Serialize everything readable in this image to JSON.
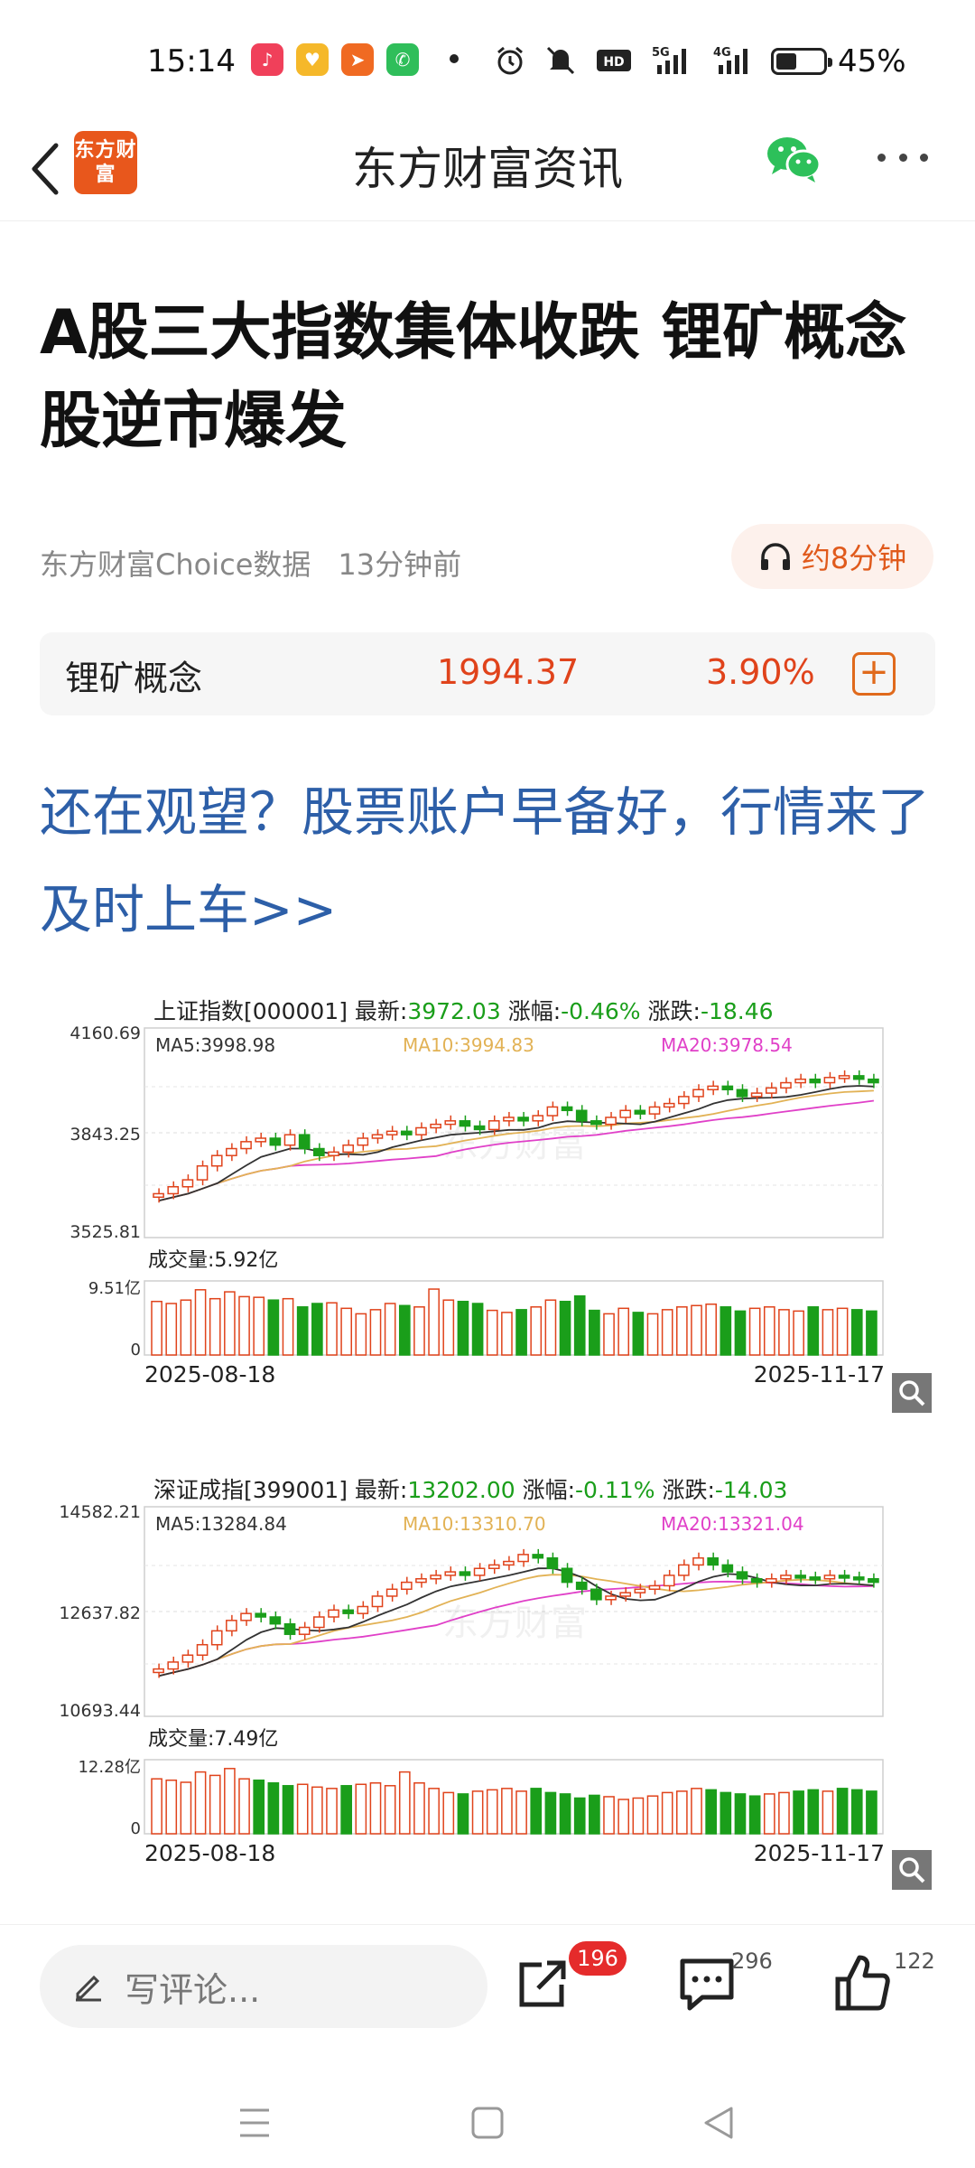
{
  "status_bar": {
    "time": "15:14",
    "battery_pct": "45%",
    "network_1": "5G",
    "network_2": "4G",
    "hd_label": "HD"
  },
  "header": {
    "logo_text": "东方财富",
    "title": "东方财富资讯"
  },
  "article": {
    "title": "A股三大指数集体收跌 锂矿概念股逆市爆发",
    "source": "东方财富Choice数据",
    "time_ago": "13分钟前",
    "listen_label": "约8分钟",
    "promo_link": "还在观望？股票账户早备好，行情来了及时上车>>"
  },
  "stock_card": {
    "name": "锂矿概念",
    "price": "1994.37",
    "change_pct": "3.90%"
  },
  "colors": {
    "up": "#e0431b",
    "down": "#1a9e1a",
    "link": "#2d5fa8",
    "accent": "#e8571c"
  },
  "charts": [
    {
      "name": "上证指数[000001]",
      "latest_label": "最新:",
      "latest": "3972.03",
      "pct_label": "涨幅:",
      "pct": "-0.46%",
      "chg_label": "涨跌:",
      "chg": "-18.46",
      "y_max": "4160.69",
      "y_mid": "3843.25",
      "y_min": "3525.81",
      "ma5": "MA5:3998.98",
      "ma10": "MA10:3994.83",
      "ma20": "MA20:3978.54",
      "volume_label": "成交量:5.92亿",
      "vol_max": "9.51亿",
      "vol_min": "0",
      "date_start": "2025-08-18",
      "date_end": "2025-11-17",
      "watermark": "东方财富"
    },
    {
      "name": "深证成指[399001]",
      "latest_label": "最新:",
      "latest": "13202.00",
      "pct_label": "涨幅:",
      "pct": "-0.11%",
      "chg_label": "涨跌:",
      "chg": "-14.03",
      "y_max": "14582.21",
      "y_mid": "12637.82",
      "y_min": "10693.44",
      "ma5": "MA5:13284.84",
      "ma10": "MA10:13310.70",
      "ma20": "MA20:13321.04",
      "volume_label": "成交量:7.49亿",
      "vol_max": "12.28亿",
      "vol_min": "0",
      "date_start": "2025-08-18",
      "date_end": "2025-11-17",
      "watermark": "东方财富"
    }
  ],
  "bottom_bar": {
    "comment_placeholder": "写评论...",
    "share_count": "196",
    "comment_count": "296",
    "like_count": "122"
  }
}
